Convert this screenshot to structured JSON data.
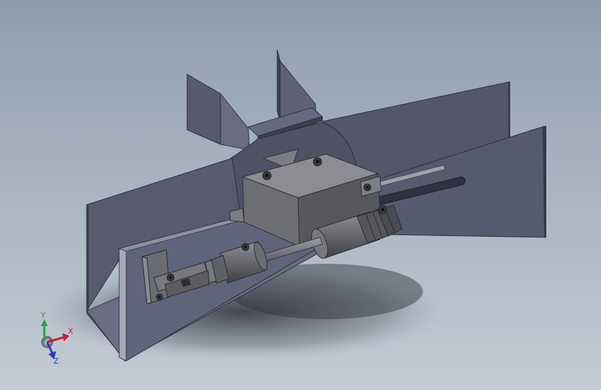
{
  "viewport": {
    "background_top": "#8e9dad",
    "background_bottom": "#c3cbd5"
  },
  "model": {
    "sheet_metal_color": "#5c5f73",
    "sheet_metal_light": "#6e7288",
    "sheet_metal_dark": "#3e4152",
    "block_color": "#74767c",
    "cylinder_color": "#6e7076"
  },
  "triad": {
    "x_label": "X",
    "y_label": "Y",
    "z_label": "Z",
    "x_color": "#c0202a",
    "y_color": "#2aa336",
    "z_color": "#2a3ab8"
  }
}
